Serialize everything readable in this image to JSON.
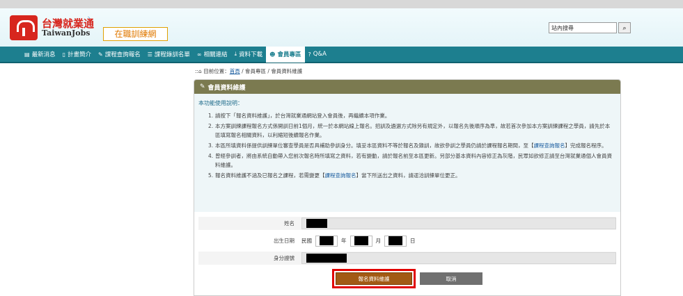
{
  "header": {
    "logo_cn": "台灣就業通",
    "logo_en": "TaiwanJobs",
    "logo_sub": "在職訓練網",
    "search_placeholder": "站內搜尋",
    "search_value": "站內搜尋"
  },
  "nav": {
    "items": [
      {
        "icon": "newspaper-icon",
        "glyph": "▤",
        "label": "最新消息"
      },
      {
        "icon": "clipboard-icon",
        "glyph": "▯",
        "label": "計畫簡介"
      },
      {
        "icon": "pencil-icon",
        "glyph": "✎",
        "label": "課程查詢報名"
      },
      {
        "icon": "list-icon",
        "glyph": "☰",
        "label": "課程錄訓名單"
      },
      {
        "icon": "link-icon",
        "glyph": "∞",
        "label": "相關連結"
      },
      {
        "icon": "download-icon",
        "glyph": "⤓",
        "label": "資料下載"
      },
      {
        "icon": "user-circle-icon",
        "glyph": "☻",
        "label": "會員專區"
      },
      {
        "icon": "question-icon",
        "glyph": "?",
        "label": "Q&A"
      }
    ],
    "active_index": 6
  },
  "breadcrumb": {
    "prefix": "目前位置：",
    "home": "首頁",
    "sep1": " / ",
    "level2": "會員專區",
    "sep2": " / ",
    "level3": "會員資料維護"
  },
  "panel": {
    "title": "會員資料維護",
    "info_title": "本功能使用說明：",
    "items": [
      {
        "n": "1.",
        "text": "請按下「報名資料維護」，於台灣就業通網站登入會員後，再繼續本項作業。"
      },
      {
        "n": "2.",
        "text": "本方案訓練課程報名方式係開訓日前1個月，統一於本網站線上報名。招訓及遴選方式除另有規定外，以報名先後順序為準，故若首次參加本方案訓練課程之學員，請先於本區填寫報名相關資料，以利縮短後續報名作業。"
      },
      {
        "n": "3.",
        "text_a": "本區所填資料係提供訓練單位審查學員是否具補助參訓身分。填妥本區資料不等於報名及錄訓，故欲參訓之學員仍請於課程報名期間，至【",
        "link": "課程查詢報名",
        "text_b": "】完成報名程序。"
      },
      {
        "n": "4.",
        "text": "曾經參訓者，將由系統自動帶入您前次報名時所填寫之資料，若有變動，請於報名前至本區更新。另部分基本資料內容修正為灰階，民眾如欲修正請至台灣就業通個人會員資料維護。"
      },
      {
        "n": "5.",
        "text_a": "報名資料維護不涵及已報名之課程，若需變更【",
        "link": "課程查詢報名",
        "text_b": "】當下所送出之資料，請逕洽訓練單位更正。"
      }
    ]
  },
  "form": {
    "name_label": "姓名",
    "birth_label": "出生日期",
    "birth_prefix": "民國",
    "year_unit": "年",
    "month_unit": "月",
    "day_unit": "日",
    "id_label": "身分證號"
  },
  "buttons": {
    "submit": "報名資料維護",
    "cancel": "取消"
  },
  "colors": {
    "nav_bg": "#1d7f8f",
    "panel_head": "#7b7a50",
    "submit_bg": "#a25a14",
    "highlight": "#e00000",
    "brand_red": "#d7261e"
  }
}
